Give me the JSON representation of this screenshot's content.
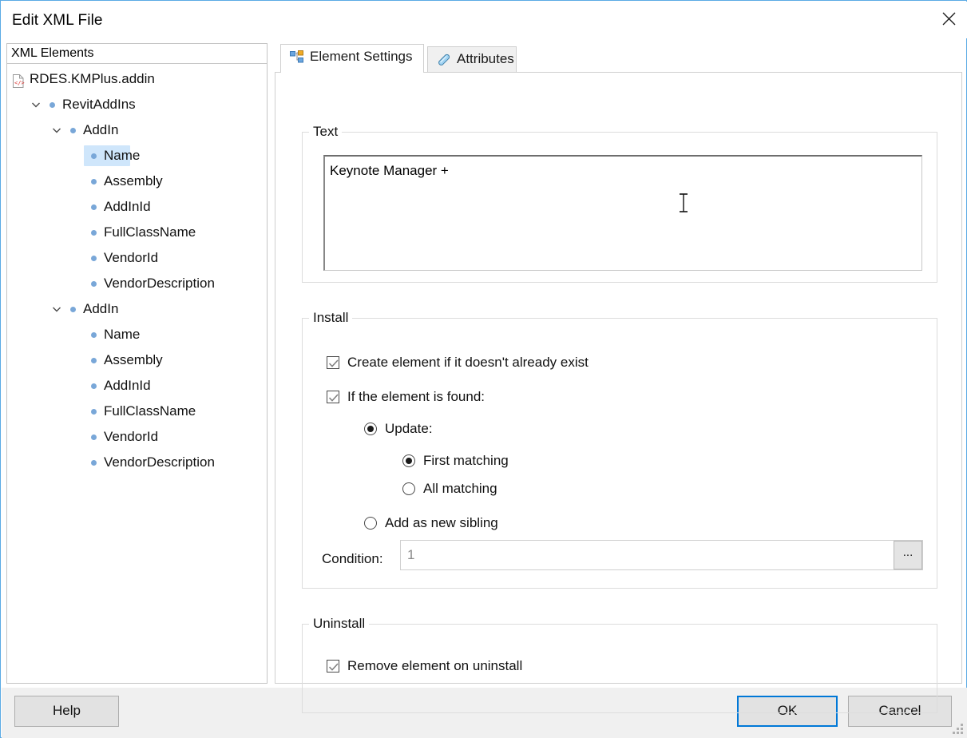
{
  "window": {
    "title": "Edit XML File",
    "close_icon": "close-x-icon",
    "accent_color": "#0078d7",
    "frame_color": "#5aaae5"
  },
  "tree_panel": {
    "header": "XML Elements",
    "nodes": [
      {
        "label": "RDES.KMPlus.addin",
        "depth": 0,
        "icon": "xml-file-icon",
        "expander": "none",
        "selected": false
      },
      {
        "label": "RevitAddIns",
        "depth": 1,
        "icon": "element-bullet-icon",
        "expander": "expanded",
        "selected": false
      },
      {
        "label": "AddIn",
        "depth": 2,
        "icon": "element-bullet-icon",
        "expander": "expanded",
        "selected": false
      },
      {
        "label": "Name",
        "depth": 3,
        "icon": "element-bullet-icon",
        "expander": "none",
        "selected": true
      },
      {
        "label": "Assembly",
        "depth": 3,
        "icon": "element-bullet-icon",
        "expander": "none",
        "selected": false
      },
      {
        "label": "AddInId",
        "depth": 3,
        "icon": "element-bullet-icon",
        "expander": "none",
        "selected": false
      },
      {
        "label": "FullClassName",
        "depth": 3,
        "icon": "element-bullet-icon",
        "expander": "none",
        "selected": false
      },
      {
        "label": "VendorId",
        "depth": 3,
        "icon": "element-bullet-icon",
        "expander": "none",
        "selected": false
      },
      {
        "label": "VendorDescription",
        "depth": 3,
        "icon": "element-bullet-icon",
        "expander": "none",
        "selected": false
      },
      {
        "label": "AddIn",
        "depth": 2,
        "icon": "element-bullet-icon",
        "expander": "expanded",
        "selected": false
      },
      {
        "label": "Name",
        "depth": 3,
        "icon": "element-bullet-icon",
        "expander": "none",
        "selected": false
      },
      {
        "label": "Assembly",
        "depth": 3,
        "icon": "element-bullet-icon",
        "expander": "none",
        "selected": false
      },
      {
        "label": "AddInId",
        "depth": 3,
        "icon": "element-bullet-icon",
        "expander": "none",
        "selected": false
      },
      {
        "label": "FullClassName",
        "depth": 3,
        "icon": "element-bullet-icon",
        "expander": "none",
        "selected": false
      },
      {
        "label": "VendorId",
        "depth": 3,
        "icon": "element-bullet-icon",
        "expander": "none",
        "selected": false
      },
      {
        "label": "VendorDescription",
        "depth": 3,
        "icon": "element-bullet-icon",
        "expander": "none",
        "selected": false
      }
    ]
  },
  "tabs": [
    {
      "label": "Element Settings",
      "icon": "hierarchy-tree-icon",
      "active": true
    },
    {
      "label": "Attributes",
      "icon": "tag-icon",
      "active": false
    }
  ],
  "text_group": {
    "title": "Text",
    "value": "Keynote Manager +"
  },
  "install_group": {
    "title": "Install",
    "create_if_missing": {
      "label": "Create element if it doesn't already exist",
      "checked": true
    },
    "if_found": {
      "label": "If the element is found:",
      "checked": true
    },
    "update": {
      "label": "Update:",
      "selected": true
    },
    "first_matching": {
      "label": "First matching",
      "selected": true
    },
    "all_matching": {
      "label": "All matching",
      "selected": false
    },
    "add_sibling": {
      "label": "Add as new sibling",
      "selected": false
    },
    "condition": {
      "label": "Condition:",
      "value": "1",
      "browse_label": "..."
    }
  },
  "uninstall_group": {
    "title": "Uninstall",
    "remove_on_uninstall": {
      "label": "Remove element on uninstall",
      "checked": true
    }
  },
  "footer": {
    "help": "Help",
    "ok": "OK",
    "cancel": "Cancel"
  }
}
